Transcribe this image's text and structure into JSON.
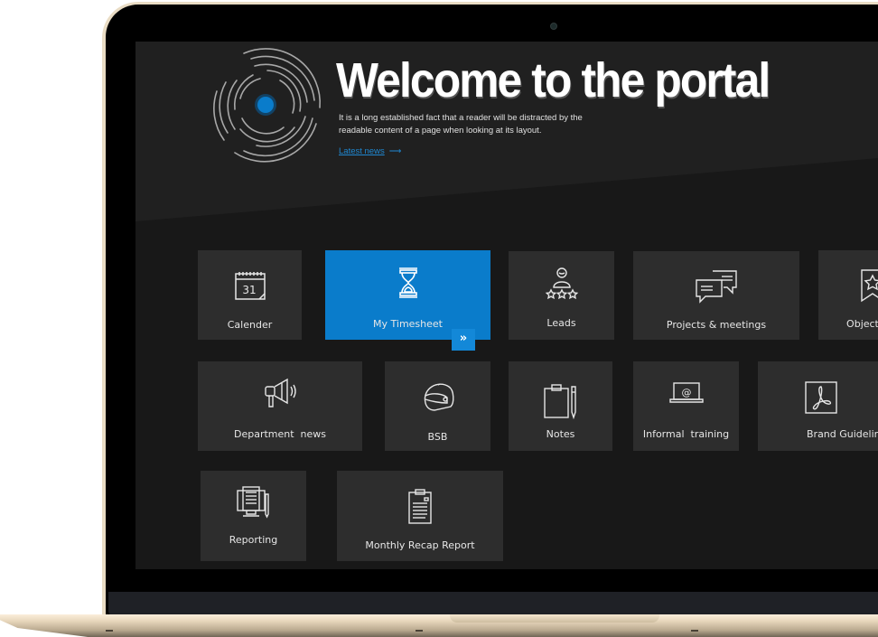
{
  "hero": {
    "title": "Welcome to the portal",
    "description": "It is a long established fact that a reader will be distracted by the readable content of a page when looking at its layout.",
    "link_label": "Latest news",
    "link_arrow": "⟶"
  },
  "colors": {
    "accent": "#0a7ccb",
    "tile_bg": "#2d2d2d",
    "screen_bg": "#181818",
    "hero_bg": "#202020",
    "link": "#1f88d2"
  },
  "tiles": [
    {
      "label": "Calender",
      "icon": "calendar-icon",
      "icon_text": "31"
    },
    {
      "label": "My Timesheet",
      "icon": "hourglass-icon",
      "active": true
    },
    {
      "label": "Leads",
      "icon": "user-rating-icon"
    },
    {
      "label": "Projects & meetings",
      "icon": "chat-bubbles-icon"
    },
    {
      "label": "Objectives",
      "icon": "ribbon-star-icon"
    },
    {
      "label": "Department  news",
      "icon": "megaphone-icon"
    },
    {
      "label": "BSB",
      "icon": "helmet-icon"
    },
    {
      "label": "Notes",
      "icon": "clipboard-pen-icon"
    },
    {
      "label": "Informal  training",
      "icon": "laptop-at-icon",
      "icon_text": "@"
    },
    {
      "label": "Brand Guidelines",
      "icon": "pdf-icon"
    },
    {
      "label": "Reporting",
      "icon": "report-monitor-icon"
    },
    {
      "label": "Monthly Recap Report",
      "icon": "clipboard-list-icon"
    }
  ],
  "active_tile_action": "»"
}
